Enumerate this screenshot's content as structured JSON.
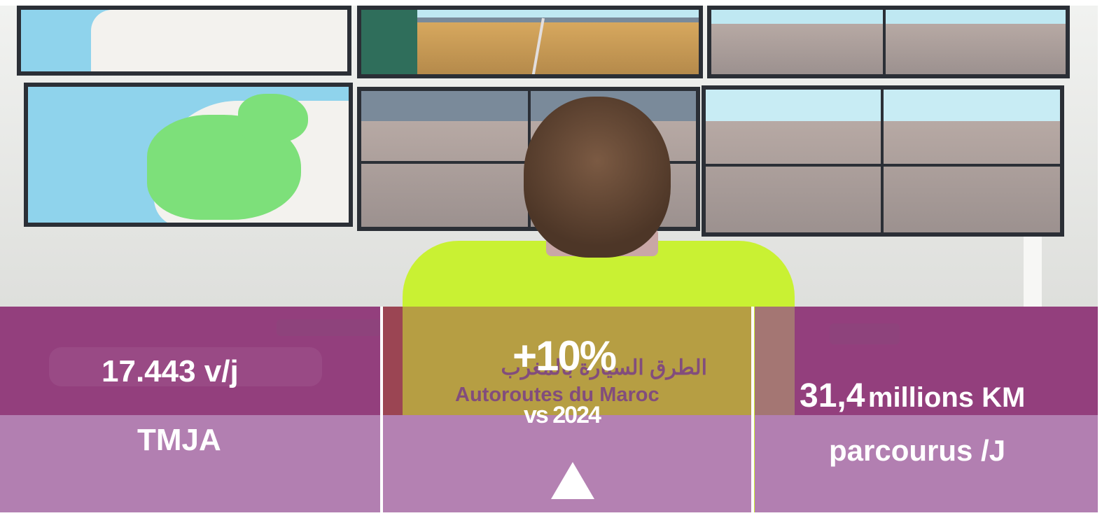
{
  "photo": {
    "vest_text_arabic": "الطرق السيارة بالمغرب",
    "vest_text_latin": "Autoroutes du Maroc"
  },
  "stats": [
    {
      "value": "17.443 v/j",
      "label": "TMJA"
    },
    {
      "value": "+10%",
      "sublabel": "vs 2024",
      "indicator": "up-triangle-icon"
    },
    {
      "value_number": "31,4",
      "value_unit": "millions KM",
      "label": "parcourus /J"
    }
  ],
  "colors": {
    "panel_dark": "#96468c",
    "panel_light": "#b27fb1",
    "text": "#ffffff"
  }
}
